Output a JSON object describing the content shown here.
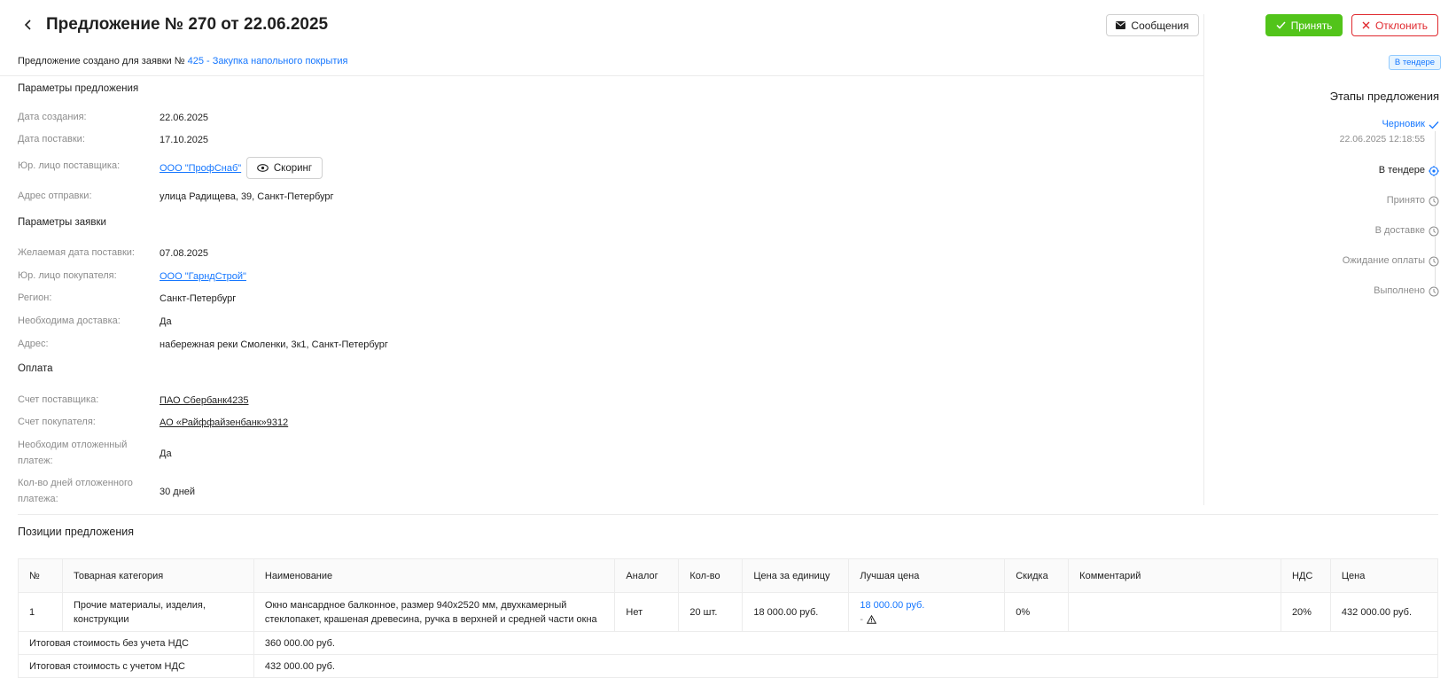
{
  "header": {
    "title": "Предложение № 270 от 22.06.2025",
    "messages_label": "Сообщения",
    "accept_label": "Принять",
    "reject_label": "Отклонить"
  },
  "request_line": {
    "prefix": "Предложение создано для заявки №",
    "link_text": "425 - Закупка напольного покрытия"
  },
  "offer_params": {
    "title": "Параметры предложения",
    "created_label": "Дата создания:",
    "created_value": "22.06.2025",
    "delivery_label": "Дата поставки:",
    "delivery_value": "17.10.2025",
    "supplier_label": "Юр. лицо поставщика:",
    "supplier_value": "ООО \"ПрофСнаб\"",
    "scoring_label": "Скоринг",
    "ship_addr_label": "Адрес отправки:",
    "ship_addr_value": "улица Радищева, 39, Санкт-Петербург"
  },
  "request_params": {
    "title": "Параметры заявки",
    "desired_date_label": "Желаемая дата поставки:",
    "desired_date_value": "07.08.2025",
    "buyer_label": "Юр. лицо покупателя:",
    "buyer_value": "ООО \"ГарндСтрой\"",
    "region_label": "Регион:",
    "region_value": "Санкт-Петербург",
    "delivery_needed_label": "Необходима доставка:",
    "delivery_needed_value": "Да",
    "address_label": "Адрес:",
    "address_value": "набережная реки Смоленки, 3к1, Санкт-Петербург"
  },
  "payment": {
    "title": "Оплата",
    "supplier_acc_label": "Счет поставщика:",
    "supplier_acc_value": "ПАО Сбербанк4235",
    "buyer_acc_label": "Счет покупателя:",
    "buyer_acc_value": "АО «Райффайзенбанк»9312",
    "deferred_label_1": "Необходим отложенный",
    "deferred_label_2": "платеж:",
    "deferred_value": "Да",
    "deferred_days_label_1": "Кол-во дней отложенного",
    "deferred_days_label_2": "платежа:",
    "deferred_days_value": "30 дней"
  },
  "status": {
    "tag": "В тендере",
    "stages_title": "Этапы предложения",
    "stages": [
      {
        "label": "Черновик",
        "date": "22.06.2025 12:18:55",
        "state": "done",
        "color": "#1677ff"
      },
      {
        "label": "В тендере",
        "state": "current",
        "color": "#1f1f1f"
      },
      {
        "label": "Принято",
        "state": "pending",
        "color": "#8c8c8c"
      },
      {
        "label": "В доставке",
        "state": "pending",
        "color": "#8c8c8c"
      },
      {
        "label": "Ожидание оплаты",
        "state": "pending",
        "color": "#8c8c8c"
      },
      {
        "label": "Выполнено",
        "state": "pending",
        "color": "#8c8c8c"
      }
    ]
  },
  "positions": {
    "title": "Позиции предложения",
    "columns": [
      "№",
      "Товарная категория",
      "Наименование",
      "Аналог",
      "Кол-во",
      "Цена за единицу",
      "Лучшая цена",
      "Скидка",
      "Комментарий",
      "НДС",
      "Цена"
    ],
    "rows": [
      {
        "num": "1",
        "category_1": "Прочие материалы, изделия,",
        "category_2": "конструкции",
        "name_1": "Окно мансардное балконное, размер 940х2520 мм, двухкамерный",
        "name_2": "стеклопакет, крашеная древесина, ручка в верхней и средней части окна",
        "analog": "Нет",
        "qty": "20 шт.",
        "unit_price": "18 000.00 руб.",
        "best_price": "18 000.00 руб.",
        "best_price_sub": "-",
        "discount": "0%",
        "comment": "",
        "vat": "20%",
        "price": "432 000.00 руб."
      }
    ],
    "total_no_vat_label": "Итоговая стоимость без учета НДС",
    "total_no_vat_value": "360 000.00 руб.",
    "total_vat_label": "Итоговая стоимость с учетом НДС",
    "total_vat_value": "432 000.00 руб."
  }
}
